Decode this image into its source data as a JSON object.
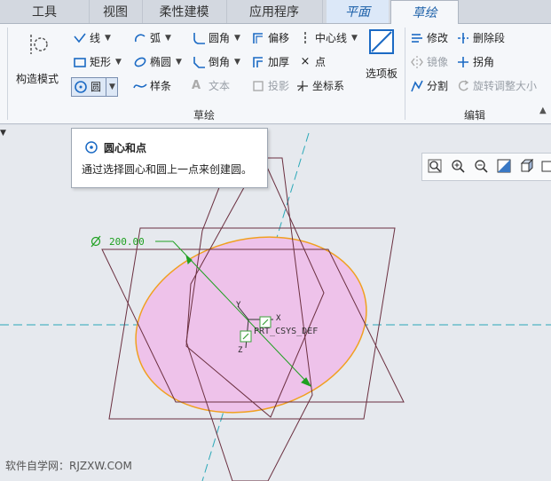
{
  "tabs": [
    "工具",
    "视图",
    "柔性建模",
    "应用程序",
    "平面",
    "草绘"
  ],
  "ribbon": {
    "construct_mode": "构造模式",
    "line": "线",
    "arc": "弧",
    "fillet": "圆角",
    "offset": "偏移",
    "centerline": "中心线",
    "rectangle": "矩形",
    "ellipse": "椭圆",
    "chamfer": "倒角",
    "thicken": "加厚",
    "point": "点",
    "circle": "圆",
    "spline": "样条",
    "text": "文本",
    "project": "投影",
    "coordsys": "坐标系",
    "palette": "选项板",
    "modify": "修改",
    "delete_segment": "删除段",
    "mirror": "镜像",
    "corner": "拐角",
    "divide": "分割",
    "rotate_resize": "旋转调整大小",
    "group_sketch": "草绘",
    "group_edit": "编辑"
  },
  "tooltip": {
    "title": "圆心和点",
    "description": "通过选择圆心和圆上一点来创建圆。"
  },
  "sketch": {
    "dimension": "200.00",
    "csys_label": "PRT_CSYS_DEF",
    "axis_x": "X",
    "axis_y": "Y",
    "axis_z": "Z"
  },
  "watermark": "软件自学网：RJZXW.COM",
  "colors": {
    "ellipse_fill": "#eec2ea",
    "ellipse_stroke": "#f0a020",
    "plane_lines": "#6b3040",
    "axis_dash": "#2aa8b8",
    "dimension": "#1ea020"
  }
}
